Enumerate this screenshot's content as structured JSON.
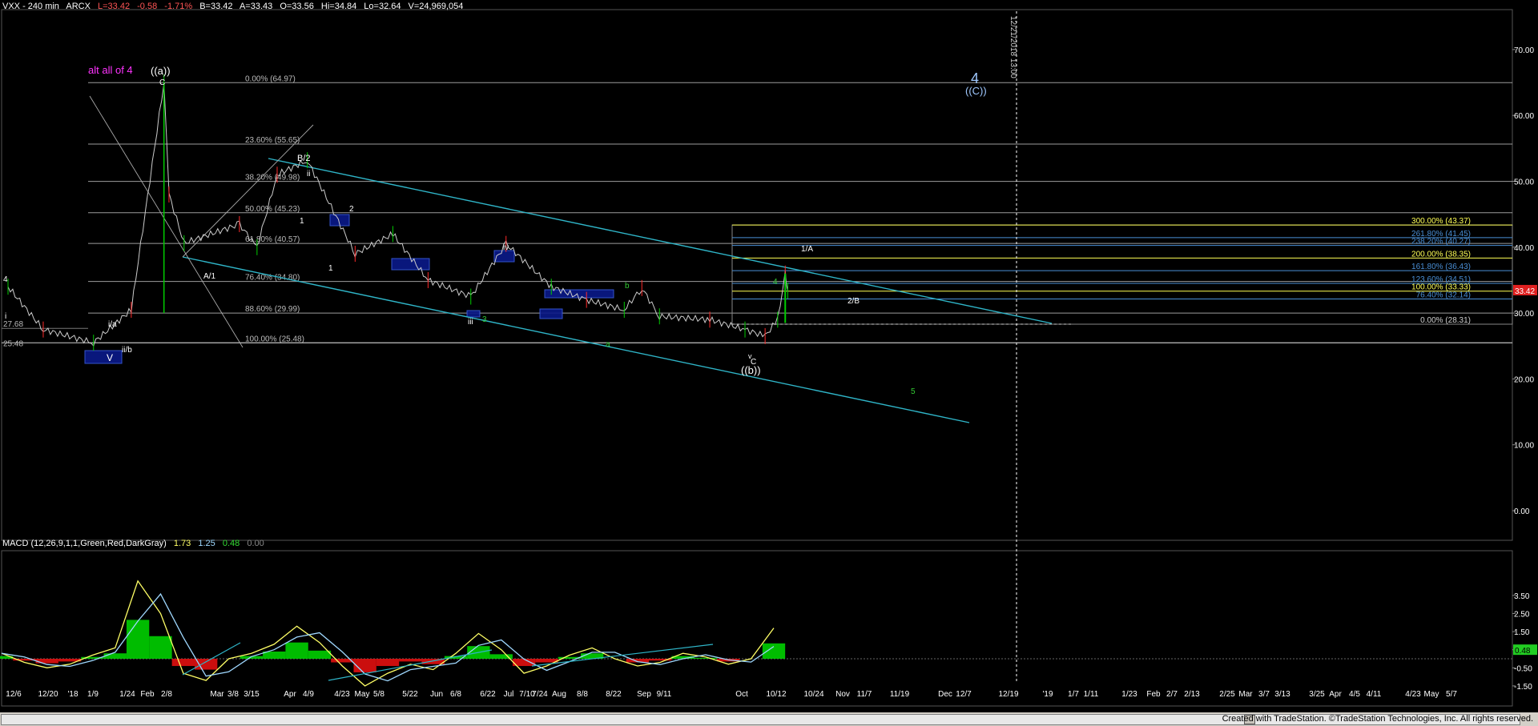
{
  "header": {
    "symbol": "VXX - 240 min",
    "exchange": "ARCX",
    "last": "L=33.42",
    "change": "-0.58",
    "change_pct": "-1.71%",
    "bid": "B=33.42",
    "ask": "A=33.43",
    "open": "O=33.56",
    "high": "Hi=34.84",
    "low": "Lo=32.64",
    "volume": "V=24,969,054"
  },
  "macd_header": {
    "label": "MACD (12,26,9,1,1,Green,Red,DarkGray)",
    "v1": "1.73",
    "v2": "1.25",
    "v3": "0.48",
    "v4": "0.00"
  },
  "colors": {
    "background": "#000000",
    "up_candle": "#00cc00",
    "down_candle": "#ff2a2a",
    "trend_line": "#2fb5c8",
    "fib_line": "#d0d0d0",
    "hist_pos": "#00dd00",
    "hist_neg": "#ee1111",
    "macd_line": "#ffff66",
    "signal_line": "#9fd8ff",
    "price_box": "#e02020",
    "alt_label": "#ff33ff",
    "wave_green": "#33cc33"
  },
  "chart_data": {
    "type": "candlestick",
    "symbol": "VXX",
    "interval": "240 min",
    "ylim": [
      0,
      75
    ],
    "y_ticks": [
      "70.00",
      "60.00",
      "50.00",
      "40.00",
      "30.00",
      "20.00",
      "10.00",
      "0.00"
    ],
    "x_ticks": [
      "12/6",
      "12/20",
      "'18",
      "1/9",
      "1/24",
      "Feb",
      "2/8",
      "Mar",
      "3/8",
      "3/15",
      "Apr",
      "4/9",
      "4/23",
      "May",
      "5/8",
      "5/22",
      "Jun",
      "6/8",
      "6/22",
      "Jul",
      "7/10",
      "7/24",
      "Aug",
      "8/8",
      "8/22",
      "Sep",
      "9/11",
      "Oct",
      "10/12",
      "10/24",
      "Nov",
      "11/7",
      "11/19",
      "Dec",
      "12/7",
      "12/19",
      "'19",
      "1/7",
      "1/11",
      "1/23",
      "Feb",
      "2/7",
      "2/13",
      "2/25",
      "Mar",
      "3/7",
      "3/13",
      "3/25",
      "Apr",
      "4/5",
      "4/11",
      "4/23",
      "May",
      "5/7"
    ],
    "current_price": "33.42",
    "vertical_marker": "12/21/2018 13:00",
    "price_tags": [
      "27.68",
      "25.48"
    ],
    "price_series_approx": [
      {
        "date": "12/6",
        "close": 34.0
      },
      {
        "date": "12/20",
        "close": 27.5
      },
      {
        "date": "1/9",
        "close": 25.5
      },
      {
        "date": "1/24",
        "close": 30.5
      },
      {
        "date": "2/6",
        "close": 64.97
      },
      {
        "date": "2/8",
        "close": 48.0
      },
      {
        "date": "2/14",
        "close": 40.6
      },
      {
        "date": "3/8",
        "close": 43.5
      },
      {
        "date": "3/15",
        "close": 40.0
      },
      {
        "date": "3/23",
        "close": 51.0
      },
      {
        "date": "4/4",
        "close": 53.2
      },
      {
        "date": "4/23",
        "close": 39.0
      },
      {
        "date": "5/8",
        "close": 42.0
      },
      {
        "date": "5/22",
        "close": 35.0
      },
      {
        "date": "6/8",
        "close": 32.5
      },
      {
        "date": "6/22",
        "close": 40.5
      },
      {
        "date": "7/10",
        "close": 34.0
      },
      {
        "date": "7/24",
        "close": 32.0
      },
      {
        "date": "8/8",
        "close": 30.5
      },
      {
        "date": "8/15",
        "close": 33.8
      },
      {
        "date": "8/22",
        "close": 29.5
      },
      {
        "date": "9/11",
        "close": 29.0
      },
      {
        "date": "9/25",
        "close": 27.5
      },
      {
        "date": "10/3",
        "close": 26.5
      },
      {
        "date": "10/8",
        "close": 29.0
      },
      {
        "date": "10/11",
        "close": 36.0
      },
      {
        "date": "10/12",
        "close": 33.42
      }
    ],
    "fib_retracement": [
      {
        "label": "0.00% (64.97)",
        "value": 64.97
      },
      {
        "label": "23.60% (55.65)",
        "value": 55.65
      },
      {
        "label": "38.20% (49.98)",
        "value": 49.98
      },
      {
        "label": "50.00% (45.23)",
        "value": 45.23
      },
      {
        "label": "61.80% (40.57)",
        "value": 40.57
      },
      {
        "label": "76.40% (34.80)",
        "value": 34.8
      },
      {
        "label": "88.60% (29.99)",
        "value": 29.99
      },
      {
        "label": "100.00% (25.48)",
        "value": 25.48
      }
    ],
    "fib_extension": [
      {
        "label": "300.00% (43.37)",
        "value": 43.37,
        "color": "#ffff55"
      },
      {
        "label": "261.80% (41.45)",
        "value": 41.45,
        "color": "#4a8fd6"
      },
      {
        "label": "238.20% (40.27)",
        "value": 40.27,
        "color": "#4a8fd6"
      },
      {
        "label": "200.00% (38.35)",
        "value": 38.35,
        "color": "#ffff55"
      },
      {
        "label": "161.80% (36.43)",
        "value": 36.43,
        "color": "#4a8fd6"
      },
      {
        "label": "123.60% (34.51)",
        "value": 34.51,
        "color": "#4a8fd6"
      },
      {
        "label": "100.00% (33.33)",
        "value": 33.33,
        "color": "#ffff55"
      },
      {
        "label": "76.40% (32.14)",
        "value": 32.14,
        "color": "#4a8fd6"
      },
      {
        "label": "0.00% (28.31)",
        "value": 28.31,
        "color": "#d0d0d0"
      }
    ],
    "wave_labels": [
      {
        "text": "alt all of 4",
        "color": "#ff33ff"
      },
      {
        "text": "((a))",
        "color": "#ffffff"
      },
      {
        "text": "C",
        "color": "#ffffff"
      },
      {
        "text": "B/2",
        "color": "#ffffff"
      },
      {
        "text": "ii",
        "color": "#ffffff"
      },
      {
        "text": "2",
        "color": "#ffffff"
      },
      {
        "text": "1",
        "color": "#ffffff"
      },
      {
        "text": "1",
        "color": "#ffffff"
      },
      {
        "text": "A/1",
        "color": "#ffffff"
      },
      {
        "text": "iv",
        "color": "#ffffff"
      },
      {
        "text": "iii",
        "color": "#ffffff"
      },
      {
        "text": "3",
        "color": "#33cc33"
      },
      {
        "text": "b",
        "color": "#33cc33"
      },
      {
        "text": "a",
        "color": "#33cc33"
      },
      {
        "text": "4",
        "color": "#33cc33"
      },
      {
        "text": "5",
        "color": "#33cc33"
      },
      {
        "text": "v",
        "color": "#ffffff"
      },
      {
        "text": "C",
        "color": "#ffffff"
      },
      {
        "text": "((b))",
        "color": "#ffffff"
      },
      {
        "text": "1/A",
        "color": "#ffffff"
      },
      {
        "text": "2/B",
        "color": "#ffffff"
      },
      {
        "text": "4",
        "color": "#9fc8ff"
      },
      {
        "text": "((C))",
        "color": "#9fc8ff"
      },
      {
        "text": "4",
        "color": "#ffffff"
      },
      {
        "text": "i",
        "color": "#ffffff"
      },
      {
        "text": "i/a",
        "color": "#ffffff"
      },
      {
        "text": "ii/b",
        "color": "#ffffff"
      },
      {
        "text": "V",
        "color": "#ffffff"
      }
    ],
    "macd": {
      "params": "12,26,9,1,1",
      "ylim": [
        -2,
        4.5
      ],
      "y_ticks": [
        "3.50",
        "2.50",
        "1.50",
        "0.50",
        "-0.50",
        "-1.50"
      ],
      "current_value": "0.48",
      "values_approx": [
        0.3,
        -0.2,
        -0.5,
        -0.3,
        0.2,
        0.6,
        4.3,
        2.5,
        -0.8,
        -1.2,
        0.0,
        0.3,
        0.8,
        1.8,
        0.9,
        -0.4,
        -1.5,
        -0.8,
        -0.3,
        -0.6,
        0.3,
        1.4,
        0.5,
        -0.8,
        -0.4,
        0.2,
        0.6,
        0.0,
        -0.4,
        -0.2,
        0.3,
        0.1,
        -0.3,
        0.0,
        1.7
      ]
    }
  },
  "footer": {
    "credit": "Created with TradeStation. ©TradeStation Technologies, Inc. All rights reserved."
  }
}
